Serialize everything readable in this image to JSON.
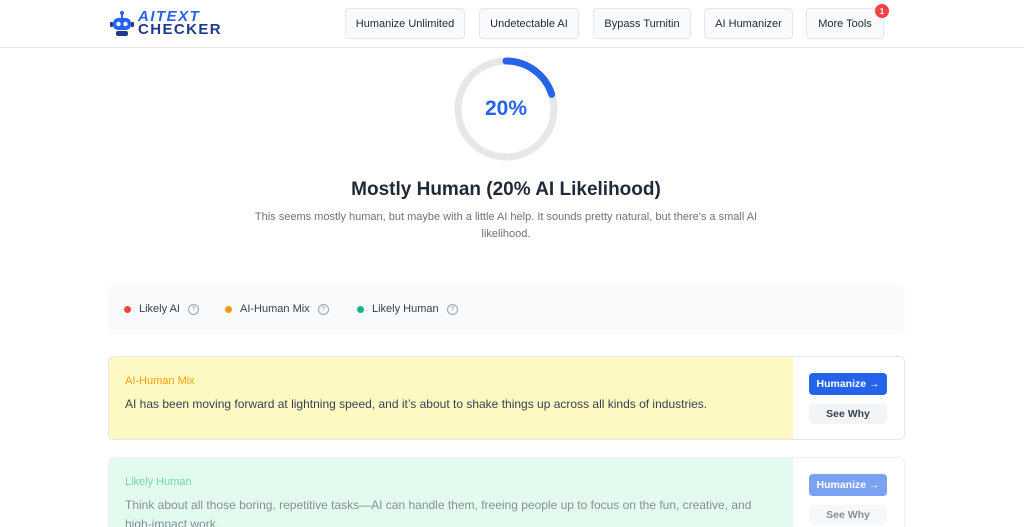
{
  "logo": {
    "line1_prefix": "AI",
    "line1_rest": "TEXT",
    "line2": "CHECKER"
  },
  "nav": [
    {
      "label": "Humanize Unlimited"
    },
    {
      "label": "Undetectable AI"
    },
    {
      "label": "Bypass Turnitin"
    },
    {
      "label": "AI Humanizer"
    },
    {
      "label": "More Tools",
      "badge": "1"
    }
  ],
  "result": {
    "percent_label": "20%",
    "percent_value": 20,
    "title": "Mostly Human (20% AI Likelihood)",
    "description": "This seems mostly human, but maybe with a little AI help. It sounds pretty natural, but there's a small AI likelihood."
  },
  "legend": [
    {
      "label": "Likely AI",
      "color": "#ef4444",
      "help": "?"
    },
    {
      "label": "AI-Human Mix",
      "color": "#f59e0b",
      "help": "?"
    },
    {
      "label": "Likely Human",
      "color": "#10b981",
      "help": "?"
    }
  ],
  "cards": [
    {
      "tag": "AI-Human Mix",
      "tag_color": "#f59e0b",
      "bg": "#fef9c3",
      "text": "AI has been moving forward at lightning speed, and it’s about to shake things up across all kinds of industries.",
      "humanize_label": "Humanize →",
      "why_label": "See Why"
    },
    {
      "tag": "Likely Human",
      "tag_color": "#10b981",
      "bg": "#ecfdf5",
      "text": "Think about all those boring, repetitive tasks—AI can handle them, freeing people up to focus on the fun, creative, and high-impact work.",
      "humanize_label": "Humanize →",
      "why_label": "See Why"
    }
  ],
  "colors": {
    "accent": "#2563eb",
    "gauge_track": "#e5e7eb"
  }
}
